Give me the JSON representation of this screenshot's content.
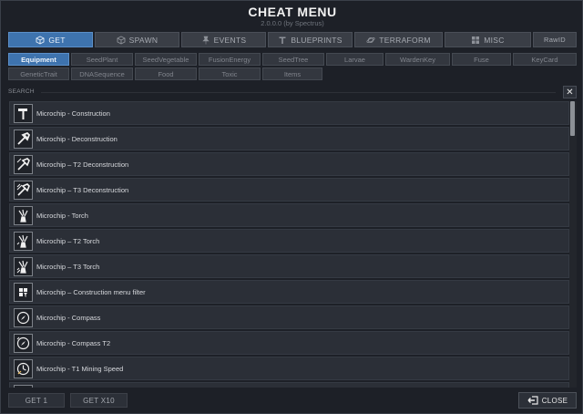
{
  "window": {
    "title": "CHEAT MENU",
    "version": "2.0.0.0  (by Spectrus)"
  },
  "tabs": [
    {
      "label": "GET",
      "icon": "cube-icon",
      "active": true
    },
    {
      "label": "SPAWN",
      "icon": "cube-outline-icon",
      "active": false
    },
    {
      "label": "EVENTS",
      "icon": "pin-icon",
      "active": false
    },
    {
      "label": "BLUEPRINTS",
      "icon": "t-icon",
      "active": false
    },
    {
      "label": "TERRAFORM",
      "icon": "planet-icon",
      "active": false
    },
    {
      "label": "MISC",
      "icon": "grid-icon",
      "active": false
    },
    {
      "label": "RawID",
      "icon": "",
      "active": false
    }
  ],
  "categories": [
    {
      "label": "Equipment",
      "active": true
    },
    {
      "label": "SeedPlant"
    },
    {
      "label": "SeedVegetable"
    },
    {
      "label": "FusionEnergy"
    },
    {
      "label": "SeedTree"
    },
    {
      "label": "Larvae"
    },
    {
      "label": "WardenKey"
    },
    {
      "label": "Fuse"
    },
    {
      "label": "KeyCard"
    },
    {
      "label": "GeneticTrait"
    },
    {
      "label": "DNASequence"
    },
    {
      "label": "Food"
    },
    {
      "label": "Toxic"
    },
    {
      "label": "Items"
    }
  ],
  "search": {
    "label": "SEARCH",
    "clear": "✕"
  },
  "items": [
    {
      "label": "Microchip - Construction",
      "icon": "hammer-icon"
    },
    {
      "label": "Microchip - Deconstruction",
      "icon": "deconstruct-icon"
    },
    {
      "label": "Microchip – T2 Deconstruction",
      "icon": "deconstruct-t2-icon"
    },
    {
      "label": "Microchip – T3 Deconstruction",
      "icon": "deconstruct-t3-icon"
    },
    {
      "label": "Microchip - Torch",
      "icon": "torch-icon"
    },
    {
      "label": "Microchip – T2 Torch",
      "icon": "torch-t2-icon"
    },
    {
      "label": "Microchip – T3 Torch",
      "icon": "torch-t3-icon"
    },
    {
      "label": "Microchip – Construction menu filter",
      "icon": "filter-icon"
    },
    {
      "label": "Microchip - Compass",
      "icon": "compass-icon"
    },
    {
      "label": "Microchip - Compass T2",
      "icon": "compass-t2-icon"
    },
    {
      "label": "Microchip - T1 Mining Speed",
      "icon": "mining-speed-icon"
    }
  ],
  "footer": {
    "get1": "GET 1",
    "getx10": "GET X10",
    "close": "CLOSE"
  }
}
